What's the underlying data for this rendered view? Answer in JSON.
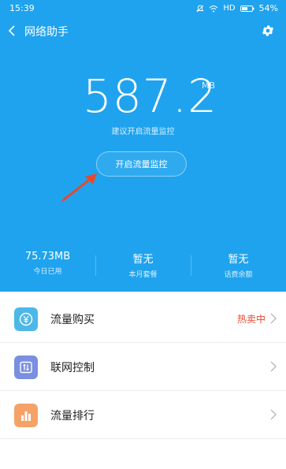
{
  "status_bar": {
    "time": "15:39",
    "network": "HD",
    "battery": "54%"
  },
  "header": {
    "title": "网络助手"
  },
  "usage": {
    "value": "587.2",
    "unit": "MB",
    "hint": "建议开启流量监控"
  },
  "enable_button": {
    "label": "开启流量监控"
  },
  "stats": [
    {
      "value": "75.73MB",
      "label": "今日已用"
    },
    {
      "value": "暂无",
      "label": "本月套餐"
    },
    {
      "value": "暂无",
      "label": "话费余额"
    }
  ],
  "menu": [
    {
      "label": "流量购买",
      "badge": "热卖中",
      "icon": "yen-icon",
      "icon_color": "#4db8e8"
    },
    {
      "label": "联网控制",
      "badge": "",
      "icon": "network-control-icon",
      "icon_color": "#7b8fe0"
    },
    {
      "label": "流量排行",
      "badge": "",
      "icon": "bar-chart-icon",
      "icon_color": "#f5a268"
    }
  ],
  "colors": {
    "primary": "#1fa3ee",
    "badge": "#e5492f",
    "arrow": "#e5492f"
  }
}
